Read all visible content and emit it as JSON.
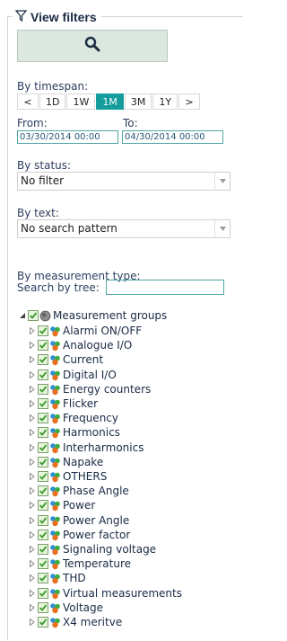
{
  "header": {
    "title": "View filters",
    "filter_icon": "funnel-icon"
  },
  "search_button": {
    "icon": "search-icon"
  },
  "timespan": {
    "label": "By timespan:",
    "buttons": [
      {
        "label": "<"
      },
      {
        "label": "1D"
      },
      {
        "label": "1W"
      },
      {
        "label": "1M",
        "active": true
      },
      {
        "label": "3M"
      },
      {
        "label": "1Y"
      },
      {
        "label": ">"
      }
    ],
    "from_label": "From:",
    "to_label": "To:",
    "from_value": "03/30/2014 00:00",
    "to_value": "04/30/2014 00:00"
  },
  "status": {
    "label": "By status:",
    "value": "No filter"
  },
  "text_filter": {
    "label": "By text:",
    "value": "No search pattern"
  },
  "measurement": {
    "label": "By measurement type:",
    "search_label": "Search by tree:",
    "search_value": ""
  },
  "tree": {
    "root": {
      "label": "Measurement groups",
      "checked": true,
      "expanded": true,
      "icon": "globe-icon"
    },
    "items": [
      {
        "label": "Alarmi ON/OFF"
      },
      {
        "label": "Analogue I/O"
      },
      {
        "label": "Current"
      },
      {
        "label": "Digital I/O"
      },
      {
        "label": "Energy counters"
      },
      {
        "label": "Flicker"
      },
      {
        "label": "Frequency"
      },
      {
        "label": "Harmonics"
      },
      {
        "label": "Interharmonics"
      },
      {
        "label": "Napake"
      },
      {
        "label": "OTHERS"
      },
      {
        "label": "Phase Angle"
      },
      {
        "label": "Power"
      },
      {
        "label": "Power Angle"
      },
      {
        "label": "Power factor"
      },
      {
        "label": "Signaling voltage"
      },
      {
        "label": "Temperature"
      },
      {
        "label": "THD"
      },
      {
        "label": "Virtual measurements"
      },
      {
        "label": "Voltage"
      },
      {
        "label": "X4 meritve"
      }
    ]
  },
  "colors": {
    "accent": "#159c9c",
    "checkbox": "#3b9a2e",
    "text": "#1a2a44"
  }
}
